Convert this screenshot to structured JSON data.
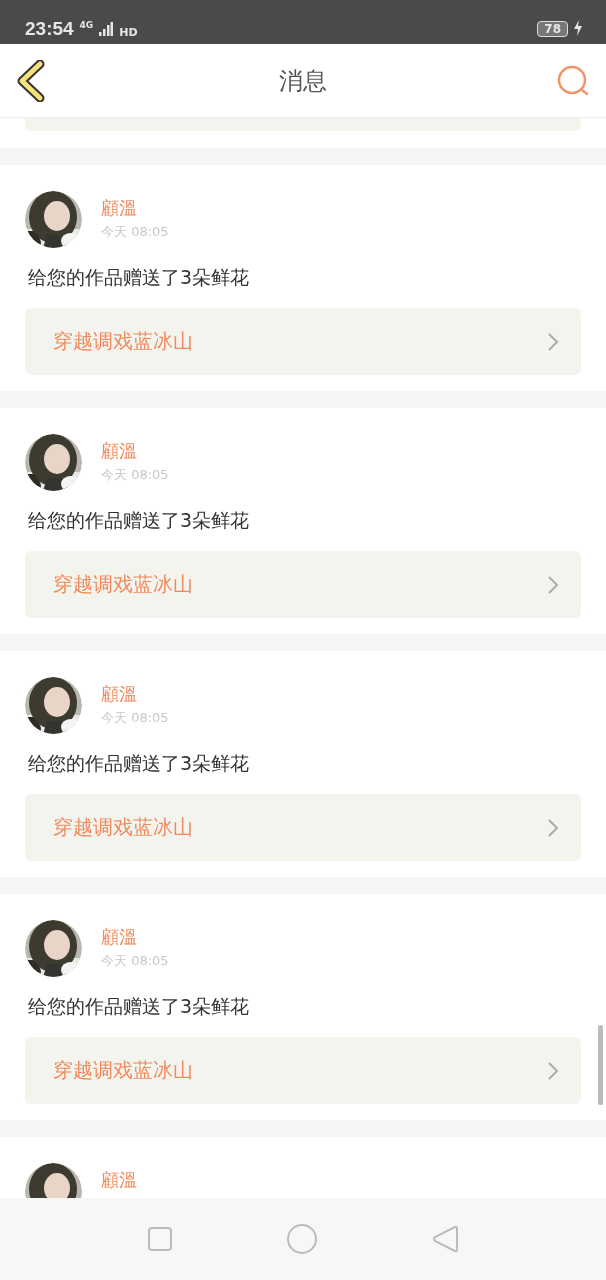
{
  "status_bar": {
    "time": "23:54",
    "network": "4G",
    "hd": "HD",
    "battery": "78"
  },
  "header": {
    "title": "消息"
  },
  "messages": [
    {
      "name": "顧溫",
      "time": "今天 08:05",
      "text": "给您的作品赠送了3朵鲜花",
      "work": "穿越调戏蓝冰山"
    },
    {
      "name": "顧溫",
      "time": "今天 08:05",
      "text": "给您的作品赠送了3朵鲜花",
      "work": "穿越调戏蓝冰山"
    },
    {
      "name": "顧溫",
      "time": "今天 08:05",
      "text": "给您的作品赠送了3朵鲜花",
      "work": "穿越调戏蓝冰山"
    },
    {
      "name": "顧溫",
      "time": "今天 08:05",
      "text": "给您的作品赠送了3朵鲜花",
      "work": "穿越调戏蓝冰山"
    },
    {
      "name": "顧溫"
    }
  ]
}
